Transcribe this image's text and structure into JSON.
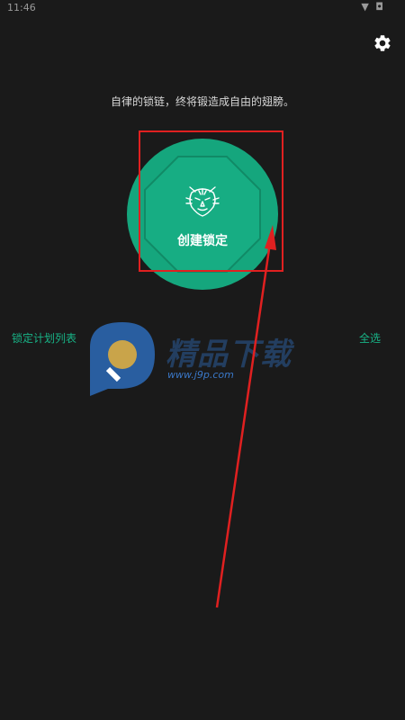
{
  "status_bar": {
    "time": "11:46",
    "icons": "▼ ◘"
  },
  "header": {
    "settings_icon": "gear-icon"
  },
  "motto": "自律的锁链，终将锻造成自由的翅膀。",
  "lock_button": {
    "label": "创建锁定",
    "icon": "tiger-icon",
    "color": "#15a67d"
  },
  "plan_list": {
    "title": "锁定计划列表",
    "select_all": "全选"
  },
  "watermark": {
    "text": "精品下载",
    "url": "www.j9p.com"
  },
  "annotation": {
    "color": "#e02020"
  }
}
